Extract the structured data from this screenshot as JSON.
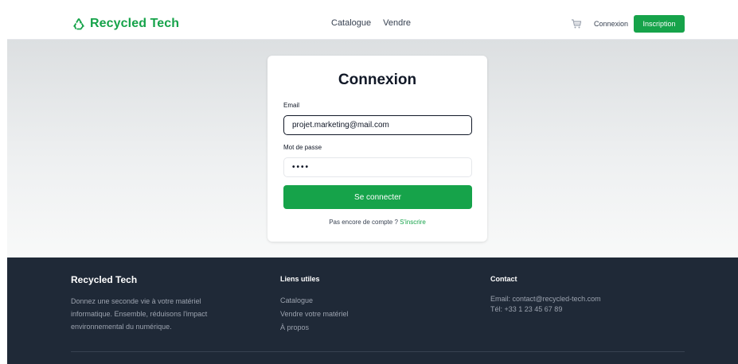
{
  "brand": {
    "name": "Recycled Tech",
    "color": "#16a34a",
    "icon": "recycle-icon"
  },
  "nav": {
    "items": [
      "Catalogue",
      "Vendre"
    ]
  },
  "header": {
    "cart_icon": "cart-icon",
    "login_label": "Connexion",
    "signup_label": "Inscription"
  },
  "login": {
    "title": "Connexion",
    "email_label": "Email",
    "email_value": "projet.marketing@mail.com",
    "password_label": "Mot de passe",
    "password_value": "••••",
    "submit_label": "Se connecter",
    "no_account_text": "Pas encore de compte ?",
    "register_link": "S'inscrire"
  },
  "footer": {
    "brand": "Recycled Tech",
    "description": "Donnez une seconde vie à votre matériel informatique. Ensemble, réduisons l'impact environnemental du numérique.",
    "links_heading": "Liens utiles",
    "links": [
      "Catalogue",
      "Vendre votre matériel",
      "À propos"
    ],
    "contact_heading": "Contact",
    "contact_email": "Email: contact@recycled-tech.com",
    "contact_phone": "Tél: +33 1 23 45 67 89"
  },
  "colors": {
    "accent": "#16a34a",
    "footer_bg": "#1f2937"
  }
}
